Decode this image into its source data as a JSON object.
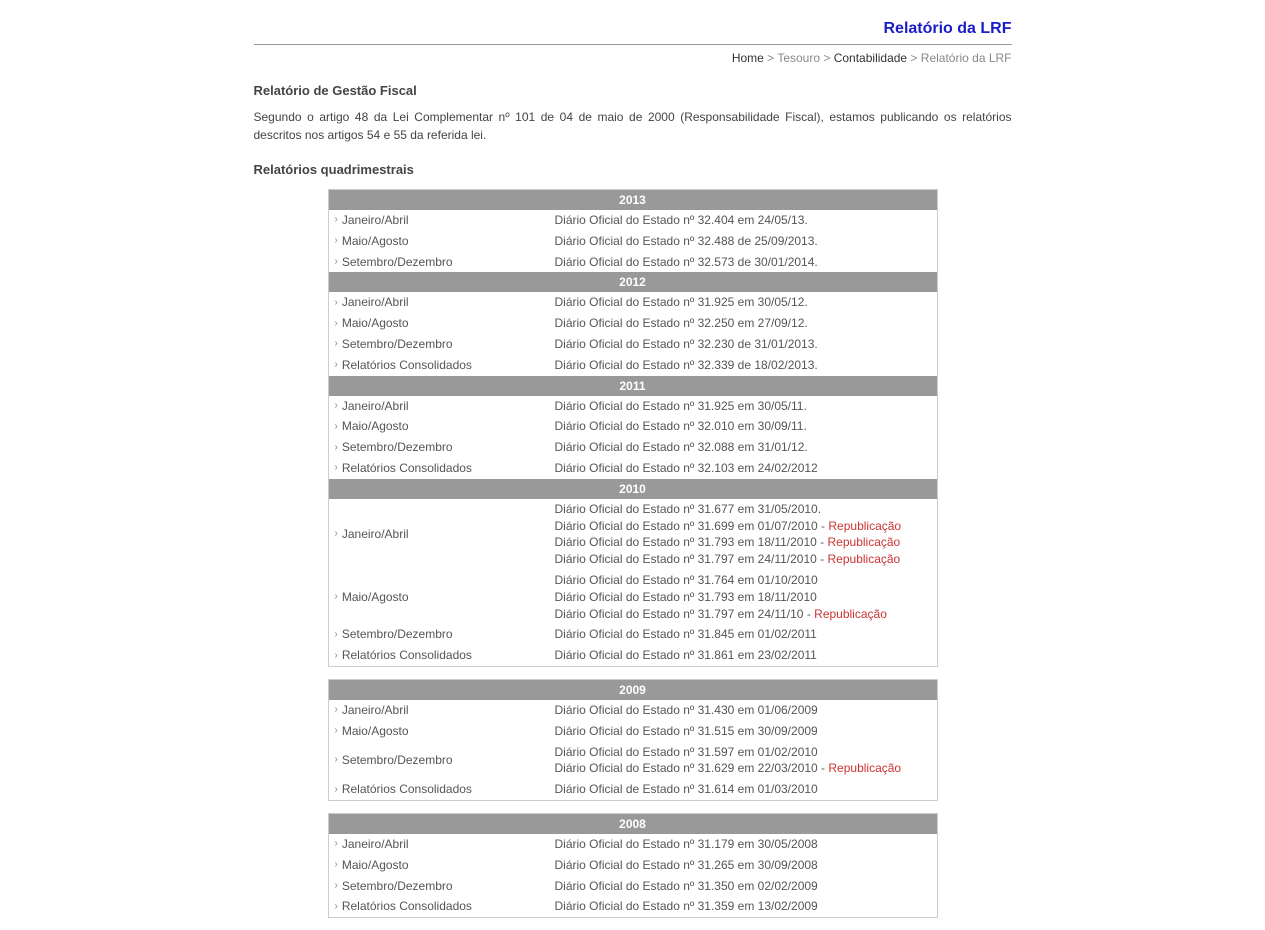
{
  "header": {
    "page_title_top": "Relatório da LRF",
    "breadcrumb": {
      "home": "Home",
      "sep": " > ",
      "l1": "Tesouro",
      "l2": "Contabilidade",
      "current": "Relatório da LRF"
    }
  },
  "content": {
    "section_title": "Relatório de Gestão Fiscal",
    "intro": "Segundo o artigo 48 da Lei Complementar nº 101 de 04 de maio de 2000 (Responsabilidade Fiscal), estamos publicando os relatórios descritos nos artigos 54 e 55 da referida lei.",
    "subheading": "Relatórios quadrimestrais"
  },
  "tables": [
    {
      "years": [
        {
          "year": "2013",
          "rows": [
            {
              "period": "Janeiro/Abril",
              "lines": [
                {
                  "text": "Diário Oficial do Estado nº 32.404 em 24/05/13."
                }
              ]
            },
            {
              "period": "Maio/Agosto",
              "lines": [
                {
                  "text": "Diário Oficial do Estado nº 32.488 de 25/09/2013."
                }
              ]
            },
            {
              "period": "Setembro/Dezembro",
              "lines": [
                {
                  "text": "Diário Oficial do Estado nº 32.573 de 30/01/2014."
                }
              ]
            }
          ]
        },
        {
          "year": "2012",
          "rows": [
            {
              "period": "Janeiro/Abril",
              "lines": [
                {
                  "text": "Diário Oficial do Estado nº 31.925 em 30/05/12."
                }
              ]
            },
            {
              "period": "Maio/Agosto",
              "lines": [
                {
                  "text": "Diário Oficial do Estado nº 32.250 em 27/09/12."
                }
              ]
            },
            {
              "period": "Setembro/Dezembro",
              "lines": [
                {
                  "text": "Diário Oficial do Estado nº 32.230 de 31/01/2013."
                }
              ]
            },
            {
              "period": "Relatórios Consolidados",
              "lines": [
                {
                  "text": "Diário Oficial do Estado nº 32.339 de 18/02/2013."
                }
              ]
            }
          ]
        },
        {
          "year": "2011",
          "rows": [
            {
              "period": "Janeiro/Abril",
              "lines": [
                {
                  "text": "Diário Oficial do Estado nº 31.925 em 30/05/11."
                }
              ]
            },
            {
              "period": "Maio/Agosto",
              "lines": [
                {
                  "text": "Diário Oficial do Estado nº 32.010 em 30/09/11."
                }
              ]
            },
            {
              "period": "Setembro/Dezembro",
              "lines": [
                {
                  "text": "Diário Oficial do Estado nº 32.088 em 31/01/12."
                }
              ]
            },
            {
              "period": "Relatórios Consolidados",
              "lines": [
                {
                  "text": "Diário Oficial do Estado nº 32.103 em 24/02/2012"
                }
              ]
            }
          ]
        },
        {
          "year": "2010",
          "rows": [
            {
              "period": "Janeiro/Abril",
              "lines": [
                {
                  "text": "Diário Oficial do Estado nº 31.677 em 31/05/2010."
                },
                {
                  "text": "Diário Oficial do Estado nº 31.699 em 01/07/2010",
                  "repub": true
                },
                {
                  "text": "Diário Oficial do Estado nº 31.793 em 18/11/2010",
                  "repub": true
                },
                {
                  "text": "Diário Oficial do Estado nº 31.797 em 24/11/2010",
                  "repub": true
                }
              ]
            },
            {
              "period": "Maio/Agosto",
              "lines": [
                {
                  "text": "Diário Oficial do Estado nº 31.764 em 01/10/2010"
                },
                {
                  "text": "Diário Oficial do Estado nº 31.793 em 18/11/2010"
                },
                {
                  "text": "Diário Oficial do Estado nº 31.797 em 24/11/10",
                  "repub": true
                }
              ]
            },
            {
              "period": "Setembro/Dezembro",
              "lines": [
                {
                  "text": "Diário Oficial do Estado nº 31.845 em 01/02/2011"
                }
              ]
            },
            {
              "period": "Relatórios Consolidados",
              "lines": [
                {
                  "text": "Diário Oficial do Estado nº 31.861 em 23/02/2011"
                }
              ]
            }
          ]
        }
      ]
    },
    {
      "years": [
        {
          "year": "2009",
          "rows": [
            {
              "period": "Janeiro/Abril",
              "lines": [
                {
                  "text": "Diário Oficial do Estado nº 31.430 em 01/06/2009"
                }
              ]
            },
            {
              "period": "Maio/Agosto",
              "lines": [
                {
                  "text": "Diário Oficial do Estado nº 31.515 em 30/09/2009"
                }
              ]
            },
            {
              "period": "Setembro/Dezembro",
              "lines": [
                {
                  "text": "Diário Oficial do Estado nº 31.597 em 01/02/2010"
                },
                {
                  "text": "Diário Oficial do Estado nº 31.629 em 22/03/2010",
                  "repub": true
                }
              ]
            },
            {
              "period": "Relatórios Consolidados",
              "lines": [
                {
                  "text": "Diário Oficial de Estado nº 31.614 em 01/03/2010"
                }
              ]
            }
          ]
        }
      ]
    },
    {
      "years": [
        {
          "year": "2008",
          "rows": [
            {
              "period": "Janeiro/Abril",
              "lines": [
                {
                  "text": "Diário Oficial do Estado nº 31.179 em 30/05/2008"
                }
              ]
            },
            {
              "period": "Maio/Agosto",
              "lines": [
                {
                  "text": "Diário Oficial do Estado nº 31.265 em 30/09/2008"
                }
              ]
            },
            {
              "period": "Setembro/Dezembro",
              "lines": [
                {
                  "text": "Diário Oficial do Estado nº 31.350 em 02/02/2009"
                }
              ]
            },
            {
              "period": "Relatórios Consolidados",
              "lines": [
                {
                  "text": "Diário Oficial do Estado nº 31.359 em 13/02/2009"
                }
              ]
            }
          ]
        }
      ]
    }
  ],
  "labels": {
    "republicacao": "Republicação"
  }
}
